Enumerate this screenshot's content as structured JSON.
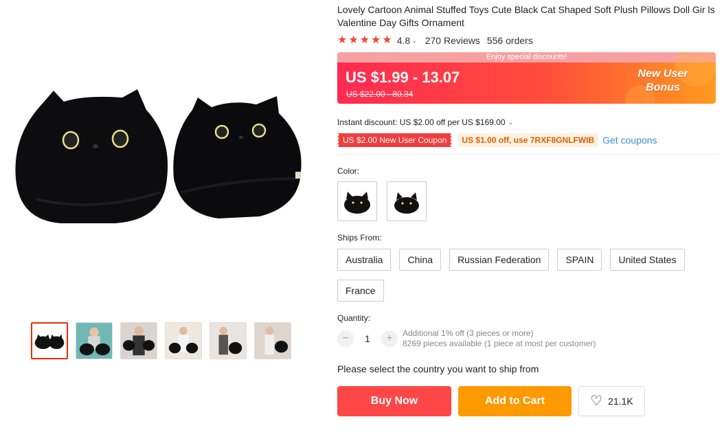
{
  "product": {
    "title": "Lovely Cartoon Animal Stuffed Toys Cute Black Cat Shaped Soft Plush Pillows Doll Gir ls Valentine Day Gifts Ornament",
    "rating": "4.8",
    "rating_caret": "⌄",
    "reviews": "270 Reviews",
    "orders": "556 orders"
  },
  "price": {
    "banner": "Enjoy special discounts!",
    "current": "US $1.99 - 13.07",
    "original": "US $22.00 - 80.34",
    "bonus_line1": "New User",
    "bonus_line2": "Bonus"
  },
  "discount": {
    "instant": "Instant discount: US $2.00 off per US $169.00",
    "coupon_new_user": "US $2.00 New User Coupon",
    "coupon_code": "US $1.00 off, use 7RXF8GNLFWIB",
    "get_coupons": "Get coupons"
  },
  "options": {
    "color_label": "Color:",
    "ships_label": "Ships From:",
    "ships": [
      "Australia",
      "China",
      "Russian Federation",
      "SPAIN",
      "United States",
      "France"
    ],
    "quantity_label": "Quantity:",
    "quantity_minus": "−",
    "quantity_plus": "+",
    "quantity": "1",
    "quantity_note1": "Additional 1% off (3 pieces or more)",
    "quantity_note2": "8269 pieces available (1 piece at most per customer)"
  },
  "shipping_prompt": "Please select the country you want to ship from",
  "actions": {
    "buy_now": "Buy Now",
    "add_to_cart": "Add to Cart",
    "wishlist_count": "21.1K"
  },
  "icons": {
    "star": "star-icon",
    "heart": "heart-icon"
  },
  "colors": {
    "accent": "#ff4747",
    "cart": "#ff9900",
    "link": "#3a8fd6",
    "coupon": "#f13d3d"
  }
}
